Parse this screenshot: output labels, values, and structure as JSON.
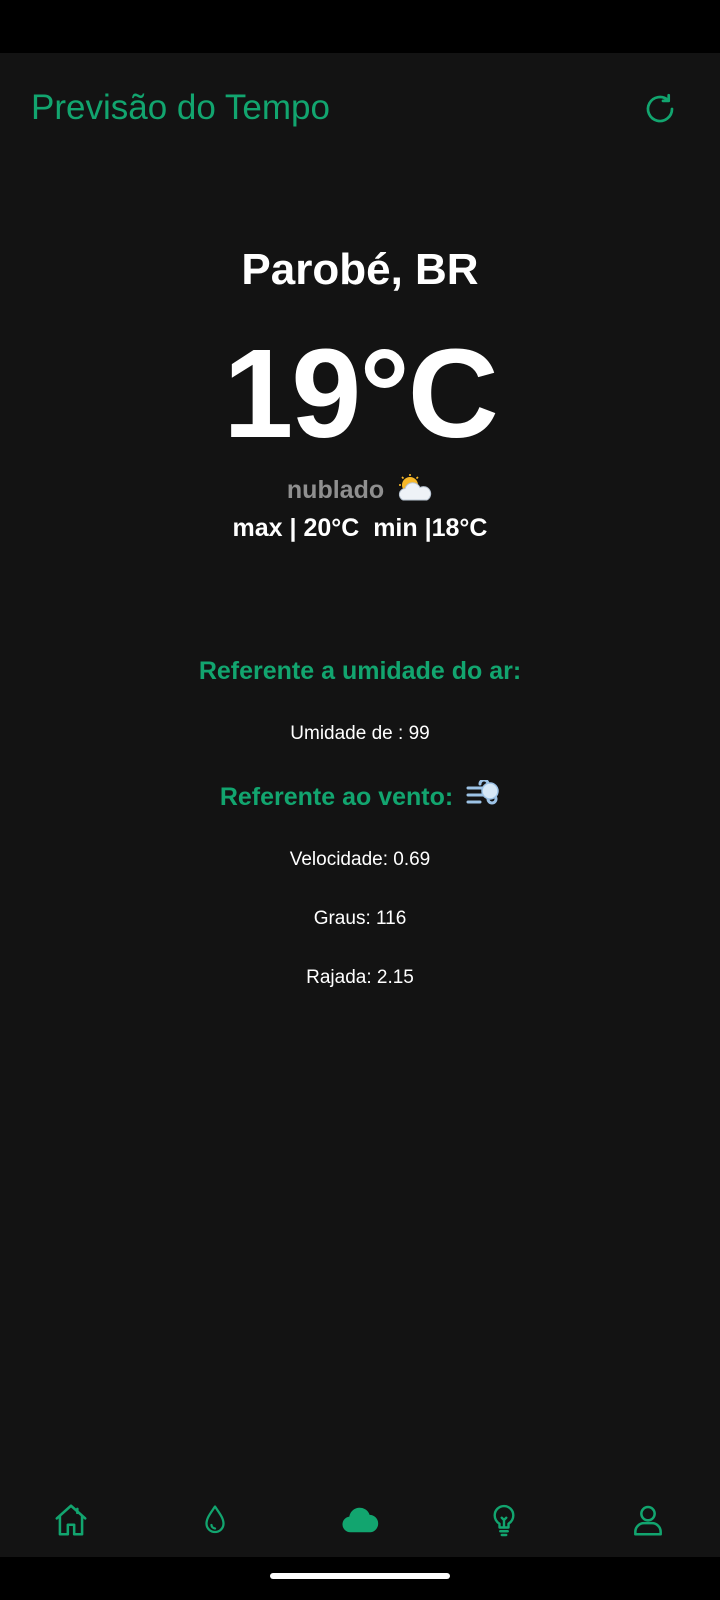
{
  "app_bar": {
    "title": "Previsão do Tempo",
    "refresh_icon": "refresh-icon"
  },
  "weather": {
    "city": "Parobé, BR",
    "temperature": "19°C",
    "condition": "nublado",
    "condition_icon": "sun-behind-cloud-icon",
    "max_min": "max | 20°C  min |18°C"
  },
  "humidity": {
    "heading": "Referente a umidade do ar:",
    "value_text": "Umidade de : 99"
  },
  "wind": {
    "heading": "Referente ao vento:",
    "heading_icon": "wind-face-icon",
    "speed_text": "Velocidade: 0.69",
    "degrees_text": "Graus: 116",
    "gust_text": "Rajada: 2.15"
  },
  "bottom_nav": {
    "items": [
      {
        "icon": "home-icon",
        "active": false
      },
      {
        "icon": "water-drop-icon",
        "active": false
      },
      {
        "icon": "cloud-icon",
        "active": true
      },
      {
        "icon": "lightbulb-icon",
        "active": false
      },
      {
        "icon": "user-icon",
        "active": false
      }
    ]
  },
  "colors": {
    "accent": "#12a56f",
    "background": "#131313",
    "text": "#ffffff",
    "muted": "#8f8f8f"
  }
}
